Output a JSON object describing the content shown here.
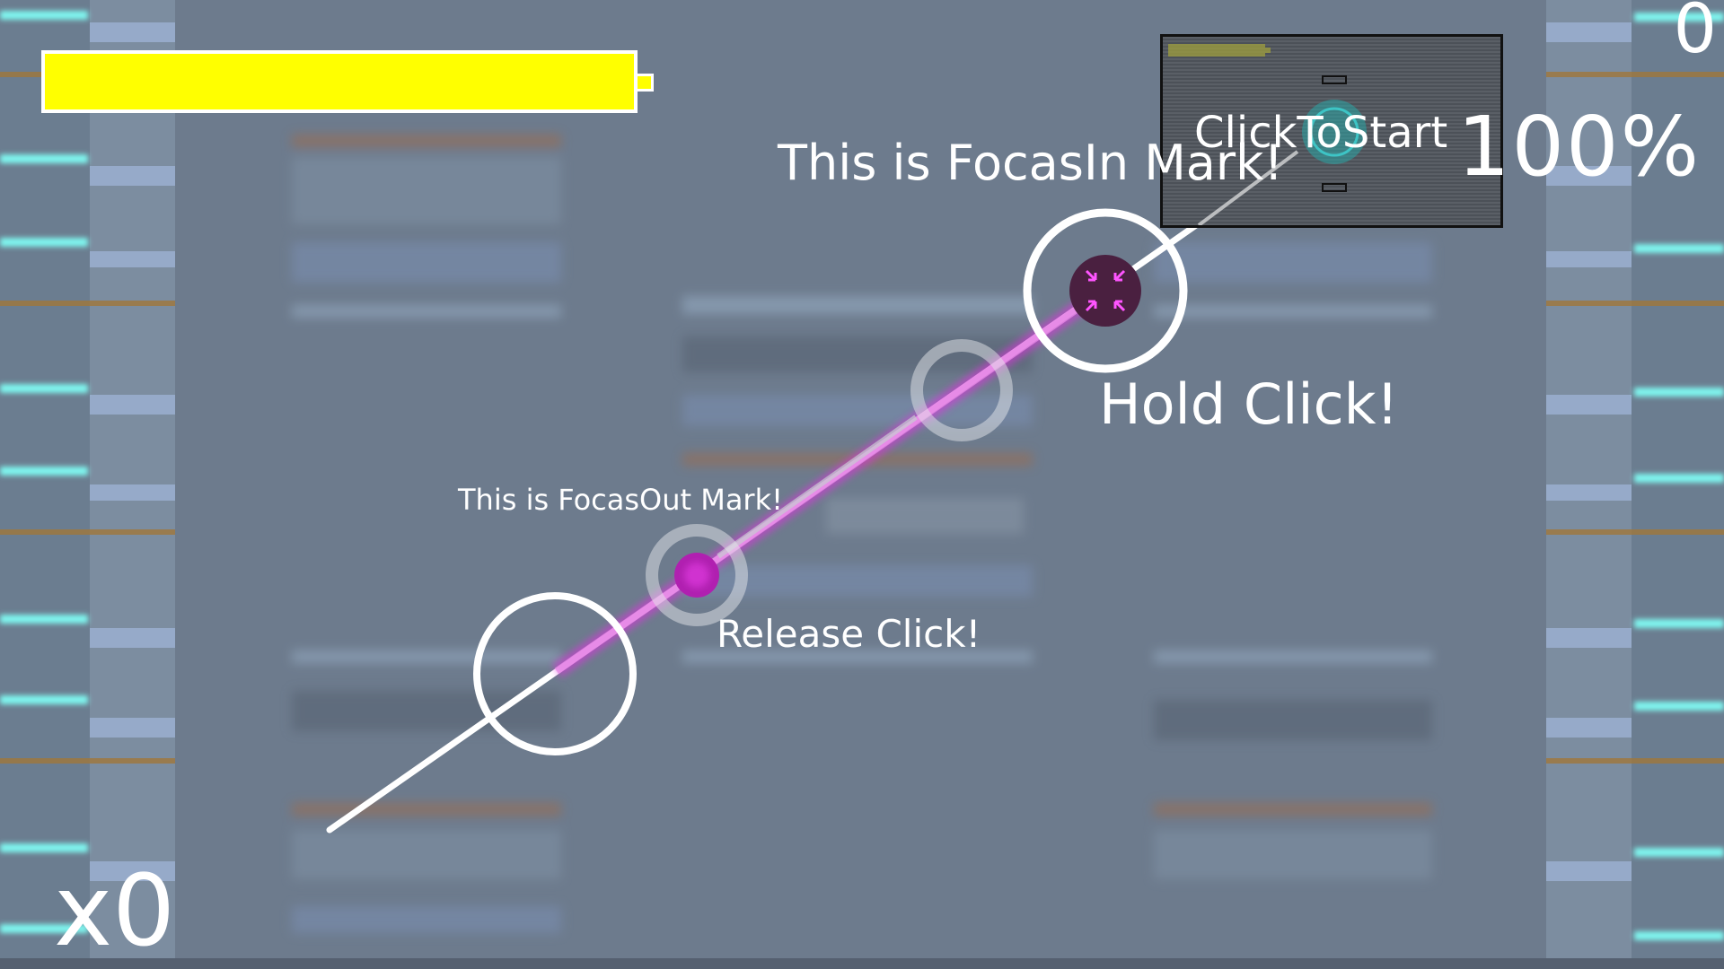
{
  "hud": {
    "score": "0",
    "accuracy": "100%",
    "combo": "x0",
    "life_fraction": 1.0
  },
  "tutorial": {
    "focus_in": "This is FocasIn Mark!",
    "hold": "Hold Click!",
    "focus_out": "This is FocasOut Mark!",
    "release": "Release Click!"
  },
  "preview": {
    "start_label": "ClickToStart"
  },
  "colors": {
    "life": "#ffff00",
    "note_accent": "#e030e0",
    "lane_glow": "#7ff5ee"
  },
  "icons": {
    "focus_in_mark": "arrows-inward-icon",
    "focus_out_mark": "dot-icon"
  }
}
